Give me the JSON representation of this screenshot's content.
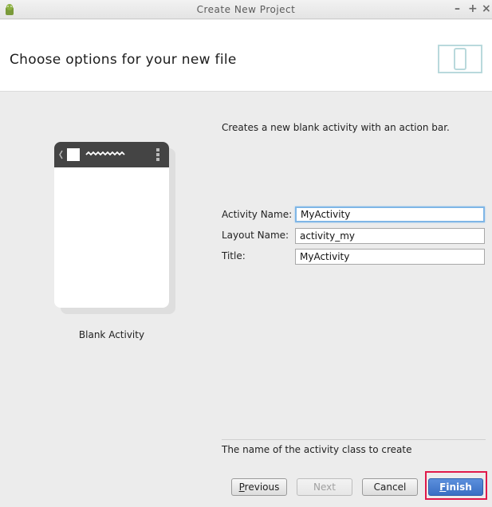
{
  "window": {
    "title": "Create New Project",
    "controls": {
      "minimize": "–",
      "maximize": "+",
      "close": "×"
    }
  },
  "header": {
    "heading": "Choose options for your new file",
    "icon": "device-frame-icon"
  },
  "template_preview": {
    "caption": "Blank Activity",
    "icons": [
      "back-chevron-icon",
      "app-icon",
      "overflow-menu-icon"
    ]
  },
  "description": "Creates a new blank activity with an action bar.",
  "form": {
    "activity_name": {
      "label": "Activity Name:",
      "value": "MyActivity"
    },
    "layout_name": {
      "label": "Layout Name:",
      "value": "activity_my"
    },
    "title": {
      "label": "Title:",
      "value": "MyActivity"
    }
  },
  "help_text": "The name of the activity class to create",
  "buttons": {
    "previous": {
      "mnemonic": "P",
      "rest": "revious"
    },
    "next": {
      "label": "Next"
    },
    "cancel": {
      "label": "Cancel"
    },
    "finish": {
      "mnemonic": "F",
      "rest": "inish"
    }
  },
  "colors": {
    "accent": "#3a6fc4",
    "highlight": "#e0194a",
    "focus": "#7fb6e6"
  }
}
